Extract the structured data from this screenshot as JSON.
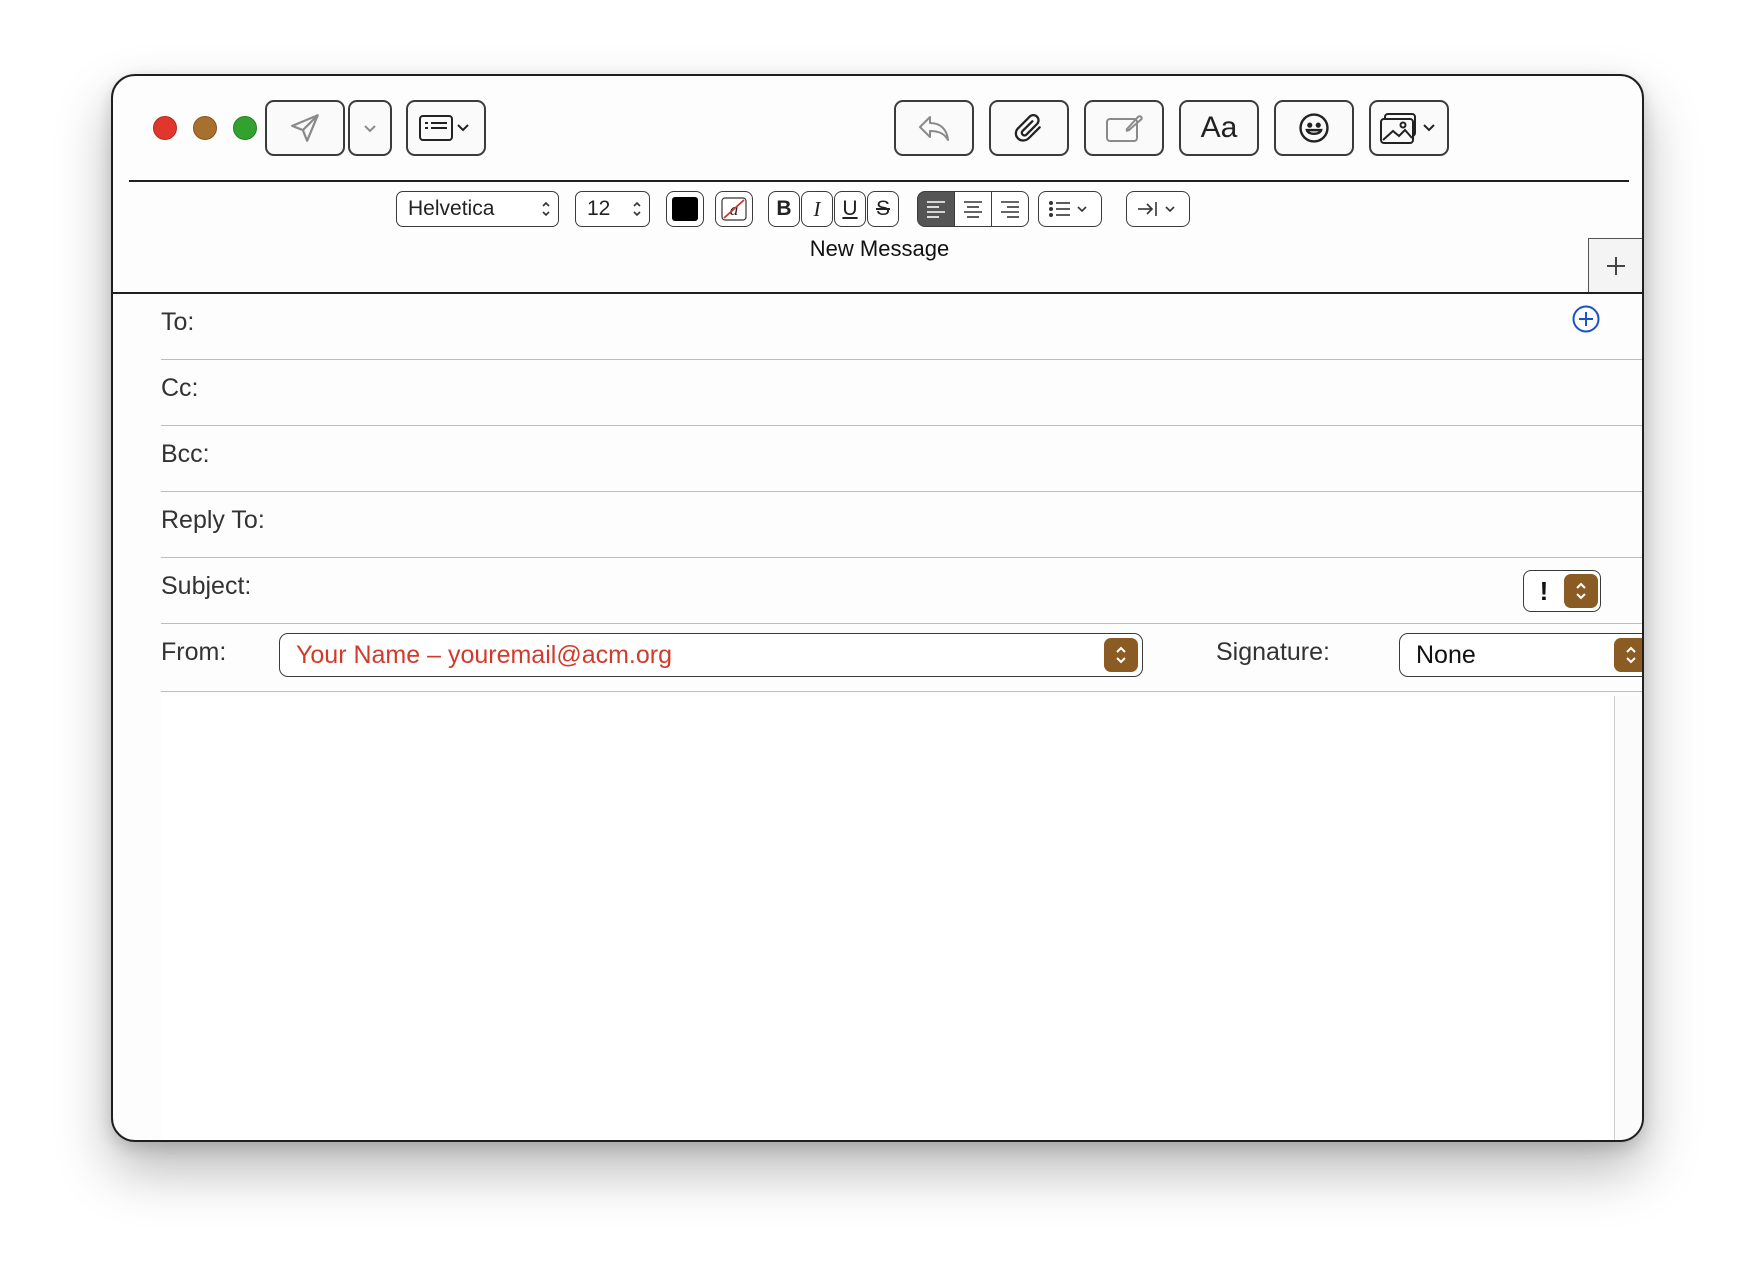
{
  "window": {
    "tab_title": "New Message"
  },
  "toolbar": {
    "buttons": [
      {
        "name": "send",
        "icon": "paper-plane-icon"
      },
      {
        "name": "send-options",
        "icon": "chevron-down-icon"
      },
      {
        "name": "header-fields",
        "icon": "header-fields-icon"
      },
      {
        "name": "reply",
        "icon": "reply-arrow-icon"
      },
      {
        "name": "attach",
        "icon": "paperclip-icon"
      },
      {
        "name": "markup",
        "icon": "markup-pen-icon"
      },
      {
        "name": "format",
        "icon": "format-text-icon",
        "label": "Aa"
      },
      {
        "name": "emoji",
        "icon": "smiley-icon"
      },
      {
        "name": "photo-browser",
        "icon": "photo-icon"
      }
    ]
  },
  "format_bar": {
    "font": "Helvetica",
    "size": "12",
    "bold": "B",
    "italic": "I",
    "underline": "U",
    "strike": "S",
    "text_color": "#000000"
  },
  "fields": {
    "to_label": "To:",
    "cc_label": "Cc:",
    "bcc_label": "Bcc:",
    "reply_to_label": "Reply To:",
    "subject_label": "Subject:",
    "priority": "!",
    "from_label": "From:",
    "from_value": "Your Name – youremail@acm.org",
    "signature_label": "Signature:",
    "signature_value": "None"
  },
  "colors": {
    "accent": "#1a50c8",
    "popup_arrow": "#8a5b22",
    "from_text": "#d03b2c",
    "close": "#e0362c",
    "minimize": "#a8702e",
    "zoom": "#33a12f"
  }
}
